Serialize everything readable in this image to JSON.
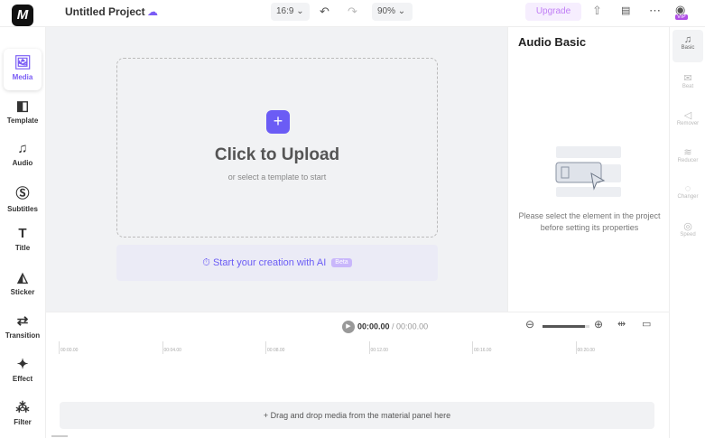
{
  "header": {
    "logo": "M",
    "title": "Untitled Project",
    "ratio": "16:9",
    "zoom": "90%",
    "upgrade": "Upgrade",
    "vip": "VIP"
  },
  "sidebar": {
    "items": [
      {
        "label": "Media",
        "icon": "media-icon"
      },
      {
        "label": "Template",
        "icon": "template-icon"
      },
      {
        "label": "Audio",
        "icon": "music-icon"
      },
      {
        "label": "Subtitles",
        "icon": "subtitles-icon"
      },
      {
        "label": "Title",
        "icon": "title-icon"
      },
      {
        "label": "Sticker",
        "icon": "sticker-icon"
      },
      {
        "label": "Transition",
        "icon": "transition-icon"
      },
      {
        "label": "Effect",
        "icon": "effect-icon"
      },
      {
        "label": "Filter",
        "icon": "filter-icon"
      }
    ]
  },
  "canvas": {
    "upload_title": "Click to Upload",
    "upload_sub": "or select a template to start",
    "ai_label": "Start your creation with AI",
    "ai_badge": "Beta"
  },
  "panel": {
    "title": "Audio Basic",
    "message": "Please select the element in the project before setting its properties"
  },
  "tools": [
    {
      "label": "Basic"
    },
    {
      "label": "Beat"
    },
    {
      "label": "Remover"
    },
    {
      "label": "Reducer"
    },
    {
      "label": "Changer"
    },
    {
      "label": "Speed"
    }
  ],
  "timeline": {
    "current": "00:00.00",
    "total": "/ 00:00.00",
    "ticks": [
      "00:00.00",
      "00:04.00",
      "00:08.00",
      "00:12.00",
      "00:16.00",
      "00:20.00"
    ],
    "zoom_level": 0.9,
    "drop_text": "+ Drag and drop media from the material panel here"
  },
  "colors": {
    "accent": "#6b5cf5"
  }
}
